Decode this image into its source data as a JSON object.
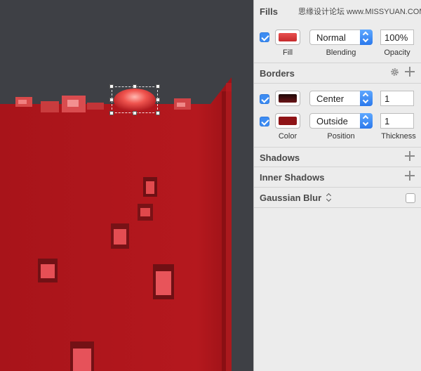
{
  "watermark": "思缘设计论坛 www.MISSYUAN.COM",
  "inspector": {
    "fills": {
      "title": "Fills",
      "row": {
        "enabled": true,
        "color": "#d8393a",
        "blending": "Normal",
        "opacity": "100%"
      },
      "captions": {
        "fill": "Fill",
        "blending": "Blending",
        "opacity": "Opacity"
      }
    },
    "borders": {
      "title": "Borders",
      "rows": [
        {
          "enabled": true,
          "color": "#3a0d0d",
          "position": "Center",
          "thickness": "1"
        },
        {
          "enabled": true,
          "color": "#8f1417",
          "position": "Outside",
          "thickness": "1"
        }
      ],
      "captions": {
        "color": "Color",
        "position": "Position",
        "thickness": "Thickness"
      }
    },
    "shadows": {
      "title": "Shadows"
    },
    "inner_shadows": {
      "title": "Inner Shadows"
    },
    "gaussian_blur": {
      "title": "Gaussian Blur",
      "enabled": false
    }
  },
  "colors": {
    "liquid": "#b4161c",
    "liquid_dark": "#8f1014",
    "canvas_bg": "#3e4045",
    "accent": "#3d8cf2"
  }
}
